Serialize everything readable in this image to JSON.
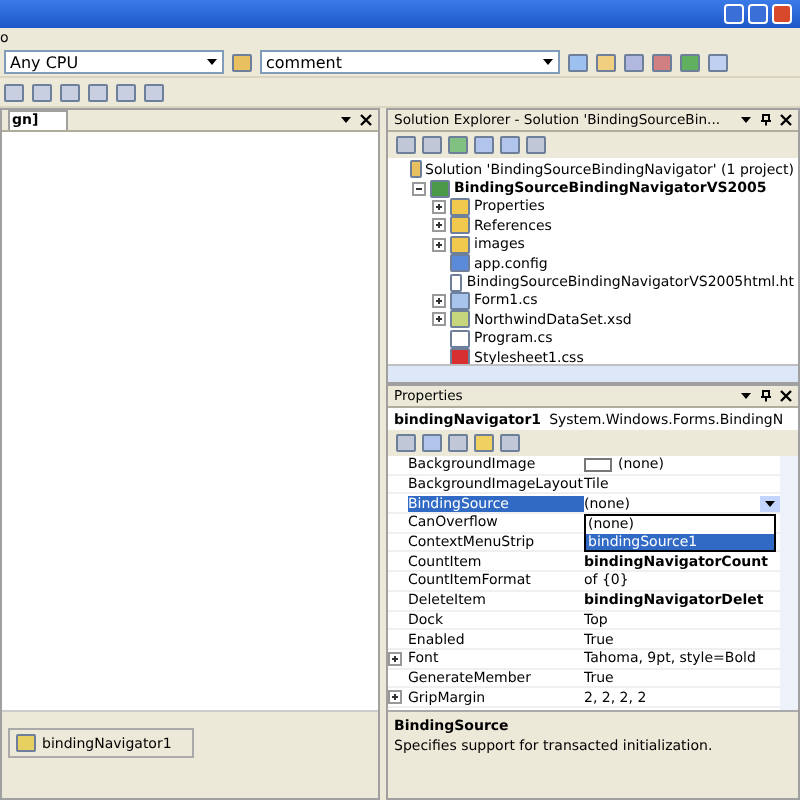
{
  "menu_bar": {
    "items": [
      "o"
    ]
  },
  "toolbar": {
    "platform": "Any CPU",
    "find": "comment"
  },
  "document": {
    "tab": "gn]",
    "tray_items": [
      "bindingNavigator1"
    ]
  },
  "solution_explorer": {
    "title": "Solution Explorer - Solution 'BindingSourceBin...",
    "tree": [
      {
        "label": "Solution 'BindingSourceBindingNavigator' (1 project)",
        "kind": "solution",
        "bold": false,
        "children": [
          {
            "label": "BindingSourceBindingNavigatorVS2005",
            "kind": "project",
            "expanded": true,
            "bold": true,
            "children": [
              {
                "label": "Properties",
                "kind": "folder",
                "expanded": false,
                "bold": false
              },
              {
                "label": "References",
                "kind": "folder",
                "expanded": false,
                "bold": false
              },
              {
                "label": "images",
                "kind": "folder",
                "expanded": false,
                "bold": false
              },
              {
                "label": "app.config",
                "kind": "config",
                "bold": false
              },
              {
                "label": "BindingSourceBindingNavigatorVS2005html.ht",
                "kind": "file",
                "bold": false
              },
              {
                "label": "Form1.cs",
                "kind": "form",
                "expanded": false,
                "bold": false
              },
              {
                "label": "NorthwindDataSet.xsd",
                "kind": "dataset",
                "expanded": false,
                "bold": false
              },
              {
                "label": "Program.cs",
                "kind": "file",
                "bold": false
              },
              {
                "label": "Stylesheet1.css",
                "kind": "css",
                "bold": false
              }
            ]
          }
        ]
      }
    ]
  },
  "properties": {
    "title": "Properties",
    "object": "bindingNavigator1",
    "object_type": "System.Windows.Forms.BindingN",
    "rows": [
      {
        "name": "BackgroundImage",
        "value": "(none)",
        "kind": "image",
        "selected": false,
        "expandable": false,
        "bold": false
      },
      {
        "name": "BackgroundImageLayout",
        "value": "Tile",
        "kind": "text",
        "selected": false,
        "expandable": false,
        "bold": false
      },
      {
        "name": "BindingSource",
        "value": "(none)",
        "kind": "dropdown",
        "selected": true,
        "expandable": false,
        "bold": false
      },
      {
        "name": "CanOverflow",
        "selected": false,
        "expandable": false
      },
      {
        "name": "ContextMenuStrip",
        "selected": false,
        "expandable": false
      },
      {
        "name": "CountItem",
        "value": "bindingNavigatorCount",
        "kind": "text",
        "selected": false,
        "expandable": false,
        "bold": true
      },
      {
        "name": "CountItemFormat",
        "value": "of {0}",
        "kind": "text",
        "selected": false,
        "expandable": false,
        "bold": false
      },
      {
        "name": "DeleteItem",
        "value": "bindingNavigatorDelet",
        "kind": "text",
        "selected": false,
        "expandable": false,
        "bold": true
      },
      {
        "name": "Dock",
        "value": "Top",
        "kind": "text",
        "selected": false,
        "expandable": false,
        "bold": false
      },
      {
        "name": "Enabled",
        "value": "True",
        "kind": "text",
        "selected": false,
        "expandable": false,
        "bold": false
      },
      {
        "name": "Font",
        "value": "Tahoma, 9pt, style=Bold",
        "kind": "text",
        "selected": false,
        "expandable": true,
        "bold": false
      },
      {
        "name": "GenerateMember",
        "value": "True",
        "kind": "text",
        "selected": false,
        "expandable": false,
        "bold": false
      },
      {
        "name": "GripMargin",
        "value": "2, 2, 2, 2",
        "kind": "text",
        "selected": false,
        "expandable": true,
        "bold": false
      }
    ],
    "dropdown_options": [
      {
        "label": "(none)",
        "selected": false
      },
      {
        "label": "bindingSource1",
        "selected": true
      }
    ],
    "description": {
      "title": "BindingSource",
      "text": "Specifies support for transacted initialization."
    }
  }
}
